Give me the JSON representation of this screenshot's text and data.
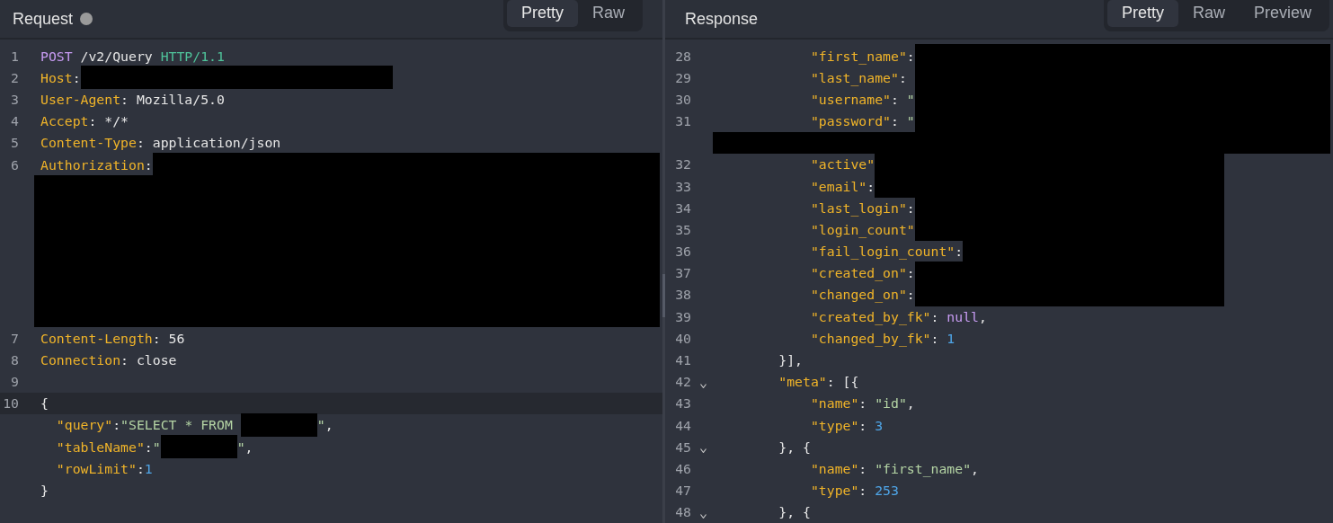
{
  "request": {
    "title": "Request",
    "tabs": [
      {
        "label": "Pretty",
        "selected": true
      },
      {
        "label": "Raw",
        "selected": false
      }
    ],
    "lines": [
      {
        "number": "1",
        "current": false,
        "foldable": false,
        "tokens": [
          {
            "kind": "method",
            "text": "POST"
          },
          {
            "kind": "plain",
            "text": " /v2/Query "
          },
          {
            "kind": "protocol",
            "text": "HTTP/1.1"
          }
        ]
      },
      {
        "number": "2",
        "current": false,
        "foldable": false,
        "tokens": [
          {
            "kind": "key",
            "text": "Host"
          },
          {
            "kind": "plain",
            "text": ":"
          },
          {
            "kind": "redaction"
          }
        ]
      },
      {
        "number": "3",
        "current": false,
        "foldable": false,
        "tokens": [
          {
            "kind": "key",
            "text": "User-Agent"
          },
          {
            "kind": "plain",
            "text": ": Mozilla/5.0"
          }
        ]
      },
      {
        "number": "4",
        "current": false,
        "foldable": false,
        "tokens": [
          {
            "kind": "key",
            "text": "Accept"
          },
          {
            "kind": "plain",
            "text": ": */*"
          }
        ]
      },
      {
        "number": "5",
        "current": false,
        "foldable": false,
        "tokens": [
          {
            "kind": "key",
            "text": "Content-Type"
          },
          {
            "kind": "plain",
            "text": ": application/json"
          }
        ]
      },
      {
        "number": "6",
        "current": false,
        "foldable": false,
        "tokens": [
          {
            "kind": "key",
            "text": "Authorization"
          },
          {
            "kind": "plain",
            "text": ":"
          },
          {
            "kind": "redaction_to_end"
          },
          {
            "kind": "redaction_block"
          }
        ]
      },
      {
        "number": "7",
        "current": false,
        "foldable": false,
        "tokens": [
          {
            "kind": "key",
            "text": "Content-Length"
          },
          {
            "kind": "plain",
            "text": ": 56"
          }
        ]
      },
      {
        "number": "8",
        "current": false,
        "foldable": false,
        "tokens": [
          {
            "kind": "key",
            "text": "Connection"
          },
          {
            "kind": "plain",
            "text": ": close"
          }
        ]
      },
      {
        "number": "9",
        "current": false,
        "foldable": false
      },
      {
        "number": "10",
        "current": true,
        "foldable": false,
        "tokens": [
          {
            "kind": "plain",
            "text": "{"
          }
        ]
      },
      {
        "current": false,
        "foldable": false,
        "tokens": [
          {
            "kind": "key",
            "text": "  \"query\""
          },
          {
            "kind": "plain",
            "text": ":"
          },
          {
            "kind": "string",
            "text": "\"SELECT * FROM "
          },
          {
            "kind": "redaction_short"
          },
          {
            "kind": "string",
            "text": "\""
          },
          {
            "kind": "plain",
            "text": ","
          }
        ]
      },
      {
        "current": false,
        "foldable": false,
        "tokens": [
          {
            "kind": "key",
            "text": "  \"tableName\""
          },
          {
            "kind": "plain",
            "text": ":"
          },
          {
            "kind": "string",
            "text": "\""
          },
          {
            "kind": "redaction_short"
          },
          {
            "kind": "string",
            "text": "\""
          },
          {
            "kind": "plain",
            "text": ","
          }
        ]
      },
      {
        "current": false,
        "foldable": false,
        "tokens": [
          {
            "kind": "key",
            "text": "  \"rowLimit\""
          },
          {
            "kind": "plain",
            "text": ":"
          },
          {
            "kind": "number",
            "text": "1"
          }
        ]
      },
      {
        "current": false,
        "foldable": false,
        "tokens": [
          {
            "kind": "plain",
            "text": "}"
          }
        ]
      }
    ]
  },
  "response": {
    "title": "Response",
    "tabs": [
      {
        "label": "Pretty",
        "selected": true
      },
      {
        "label": "Raw",
        "selected": false
      },
      {
        "label": "Preview",
        "selected": false
      }
    ],
    "lines": [
      {
        "number": "28",
        "current": false,
        "foldable": false,
        "tokens": [
          {
            "kind": "key",
            "text": "            \"first_name\""
          },
          {
            "kind": "plain",
            "text": ":"
          },
          {
            "kind": "redaction_to_end"
          }
        ]
      },
      {
        "number": "29",
        "current": false,
        "foldable": false,
        "tokens": [
          {
            "kind": "key",
            "text": "            \"last_name\""
          },
          {
            "kind": "plain",
            "text": ": "
          },
          {
            "kind": "redaction_to_end"
          }
        ]
      },
      {
        "number": "30",
        "current": false,
        "foldable": false,
        "tokens": [
          {
            "kind": "key",
            "text": "            \"username\""
          },
          {
            "kind": "plain",
            "text": ": "
          },
          {
            "kind": "string",
            "text": "\""
          },
          {
            "kind": "redaction_to_end"
          }
        ]
      },
      {
        "number": "31",
        "current": false,
        "foldable": false,
        "tokens": [
          {
            "kind": "key",
            "text": "            \"password\""
          },
          {
            "kind": "plain",
            "text": ": "
          },
          {
            "kind": "string",
            "text": "\""
          },
          {
            "kind": "redaction_to_end"
          },
          {
            "kind": "redaction_block"
          }
        ]
      },
      {
        "number": "32",
        "current": false,
        "foldable": false,
        "tokens": [
          {
            "kind": "key",
            "text": "            \"active\""
          },
          {
            "kind": "redaction"
          }
        ]
      },
      {
        "number": "33",
        "current": false,
        "foldable": false,
        "tokens": [
          {
            "kind": "key",
            "text": "            \"email\""
          },
          {
            "kind": "plain",
            "text": ":"
          },
          {
            "kind": "redaction"
          }
        ]
      },
      {
        "number": "34",
        "current": false,
        "foldable": false,
        "tokens": [
          {
            "kind": "key",
            "text": "            \"last_login\""
          },
          {
            "kind": "plain",
            "text": ":"
          },
          {
            "kind": "redaction"
          }
        ]
      },
      {
        "number": "35",
        "current": false,
        "foldable": false,
        "tokens": [
          {
            "kind": "key",
            "text": "            \"login_count\""
          },
          {
            "kind": "redaction"
          }
        ]
      },
      {
        "number": "36",
        "current": false,
        "foldable": false,
        "tokens": [
          {
            "kind": "key",
            "text": "            \"fail_login_count\""
          },
          {
            "kind": "plain",
            "text": ":"
          },
          {
            "kind": "redaction"
          }
        ]
      },
      {
        "number": "37",
        "current": false,
        "foldable": false,
        "tokens": [
          {
            "kind": "key",
            "text": "            \"created_on\""
          },
          {
            "kind": "plain",
            "text": ":"
          },
          {
            "kind": "redaction"
          }
        ]
      },
      {
        "number": "38",
        "current": false,
        "foldable": false,
        "tokens": [
          {
            "kind": "key",
            "text": "            \"changed_on\""
          },
          {
            "kind": "plain",
            "text": ":"
          },
          {
            "kind": "redaction"
          }
        ]
      },
      {
        "number": "39",
        "current": false,
        "foldable": false,
        "tokens": [
          {
            "kind": "key",
            "text": "            \"created_by_fk\""
          },
          {
            "kind": "plain",
            "text": ": "
          },
          {
            "kind": "keyword",
            "text": "null"
          },
          {
            "kind": "plain",
            "text": ","
          }
        ]
      },
      {
        "number": "40",
        "current": false,
        "foldable": false,
        "tokens": [
          {
            "kind": "key",
            "text": "            \"changed_by_fk\""
          },
          {
            "kind": "plain",
            "text": ": "
          },
          {
            "kind": "number",
            "text": "1"
          }
        ]
      },
      {
        "number": "41",
        "current": false,
        "foldable": false,
        "tokens": [
          {
            "kind": "plain",
            "text": "        }],"
          }
        ]
      },
      {
        "number": "42",
        "current": false,
        "foldable": true,
        "tokens": [
          {
            "kind": "key",
            "text": "        \"meta\""
          },
          {
            "kind": "plain",
            "text": ": [{"
          }
        ]
      },
      {
        "number": "43",
        "current": false,
        "foldable": false,
        "tokens": [
          {
            "kind": "key",
            "text": "            \"name\""
          },
          {
            "kind": "plain",
            "text": ": "
          },
          {
            "kind": "string",
            "text": "\"id\""
          },
          {
            "kind": "plain",
            "text": ","
          }
        ]
      },
      {
        "number": "44",
        "current": false,
        "foldable": false,
        "tokens": [
          {
            "kind": "key",
            "text": "            \"type\""
          },
          {
            "kind": "plain",
            "text": ": "
          },
          {
            "kind": "number",
            "text": "3"
          }
        ]
      },
      {
        "number": "45",
        "current": false,
        "foldable": true,
        "tokens": [
          {
            "kind": "plain",
            "text": "        }, {"
          }
        ]
      },
      {
        "number": "46",
        "current": false,
        "foldable": false,
        "tokens": [
          {
            "kind": "key",
            "text": "            \"name\""
          },
          {
            "kind": "plain",
            "text": ": "
          },
          {
            "kind": "string",
            "text": "\"first_name\""
          },
          {
            "kind": "plain",
            "text": ","
          }
        ]
      },
      {
        "number": "47",
        "current": false,
        "foldable": false,
        "tokens": [
          {
            "kind": "key",
            "text": "            \"type\""
          },
          {
            "kind": "plain",
            "text": ": "
          },
          {
            "kind": "number",
            "text": "253"
          }
        ]
      },
      {
        "number": "48",
        "current": false,
        "foldable": true,
        "tokens": [
          {
            "kind": "plain",
            "text": "        }, {"
          }
        ]
      }
    ]
  }
}
